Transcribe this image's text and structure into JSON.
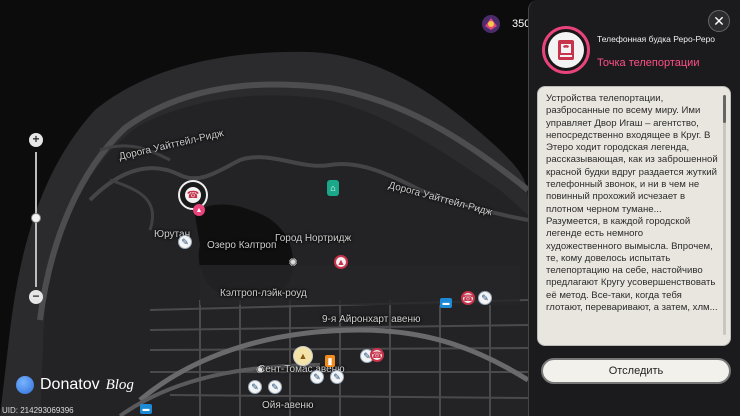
{
  "currency": {
    "value": "350",
    "icon": "polychrome-icon",
    "color": "#d9457e"
  },
  "map": {
    "labels": {
      "road_north": "Дорога Уайттейл-Ридж",
      "road_east": "Дорога Уайттейл-Ридж",
      "yurutan": "Юрутан",
      "lake": "Озеро Кэлтроп",
      "city": "Город Нортридж",
      "caltrop_road": "Кэлтроп-лэйк-роуд",
      "avenue9": "9-я Айронхарт авеню",
      "st_tomas": "Сент-Томас авеню",
      "oya": "Ойя-авеню"
    },
    "colors": {
      "land": "#2a2a2c",
      "road": "#555558",
      "background": "#0c0c0d",
      "accent": "#e8437b"
    }
  },
  "watermark": {
    "brand": "Donatov",
    "blog": "Blog",
    "uid": "UID: 214293069396"
  },
  "panel": {
    "title": "Телефонная будка Реро-Реро",
    "subtitle": "Точка телепортации",
    "description": "Устройства телепортации, разбросанные по всему миру. Ими управляет Двор Игаш – агентство, непосредственно входящее в Круг. В Этеро ходит городская легенда, рассказывающая, как из заброшенной красной будки вдруг раздается жуткий телефонный звонок, и ни в чем не повинный прохожий исчезает в плотном черном тумане... Разумеется, в каждой городской легенде есть немного художественного вымысла. Впрочем, те, кому довелось испытать телепортацию на себе, настойчиво предлагают Кругу усовершенствовать её метод. Все-таки, когда тебя глотают, переваривают, а затем, хлм...",
    "track_button": "Отследить",
    "close_icon": "close-icon",
    "poi_icon": "phone-booth-icon"
  }
}
